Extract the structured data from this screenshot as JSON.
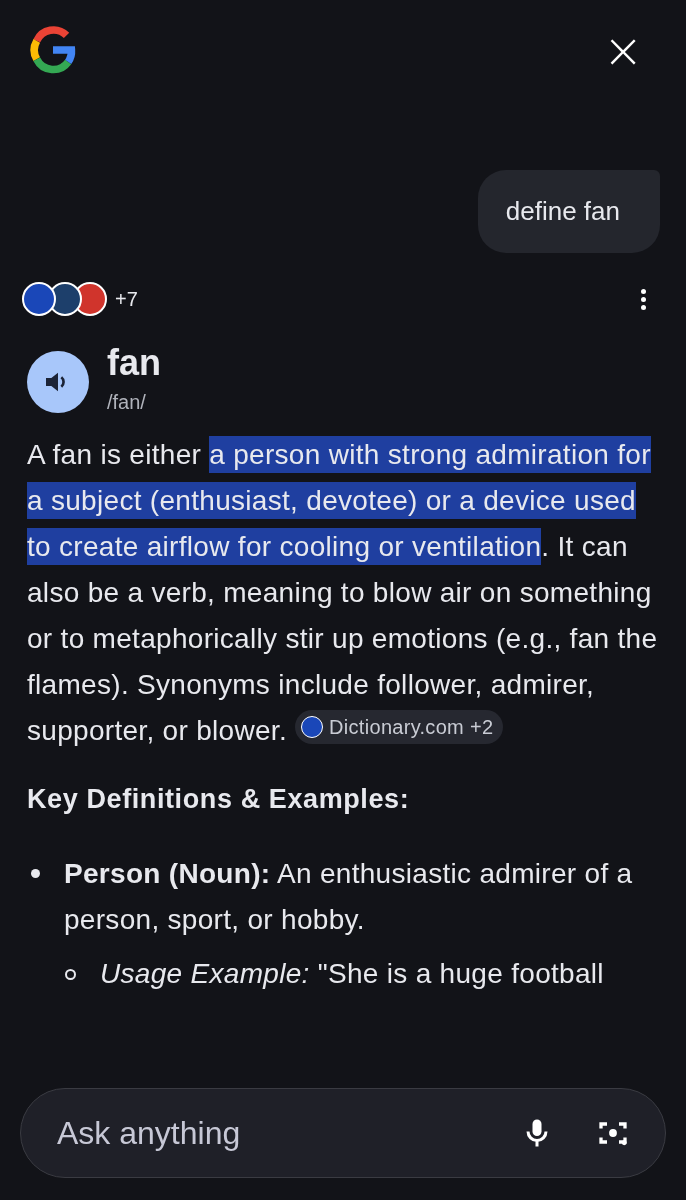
{
  "header": {
    "close_label": "×"
  },
  "query": {
    "text": "define fan"
  },
  "sources": {
    "count": "+7"
  },
  "entry": {
    "word": "fan",
    "pronunciation": "/fan/"
  },
  "summary": [
    {
      "text": "A fan is either ",
      "highlighted": false
    },
    {
      "text": "a person with strong admiration for a subject (enthusiast, devotee) or a device used to create airflow for cooling or ventilation",
      "highlighted": true
    },
    {
      "text": ". It can also be a verb, meaning to blow air on something or to metaphorically stir up emotions (e.g., fan the flames). Synonyms include follower, admirer, supporter, or blower. ",
      "highlighted": false
    }
  ],
  "source_chip": {
    "label": "Dictionary.com +2"
  },
  "section_heading": "Key Definitions & Examples:",
  "bullets": [
    {
      "text": "**Person (Noun):** An enthusiastic admirer of a person, sport, or hobby.",
      "children": [
        {
          "text": "*Usage Example:* \"She is a huge football"
        }
      ]
    }
  ],
  "input": {
    "placeholder": "Ask anything"
  }
}
